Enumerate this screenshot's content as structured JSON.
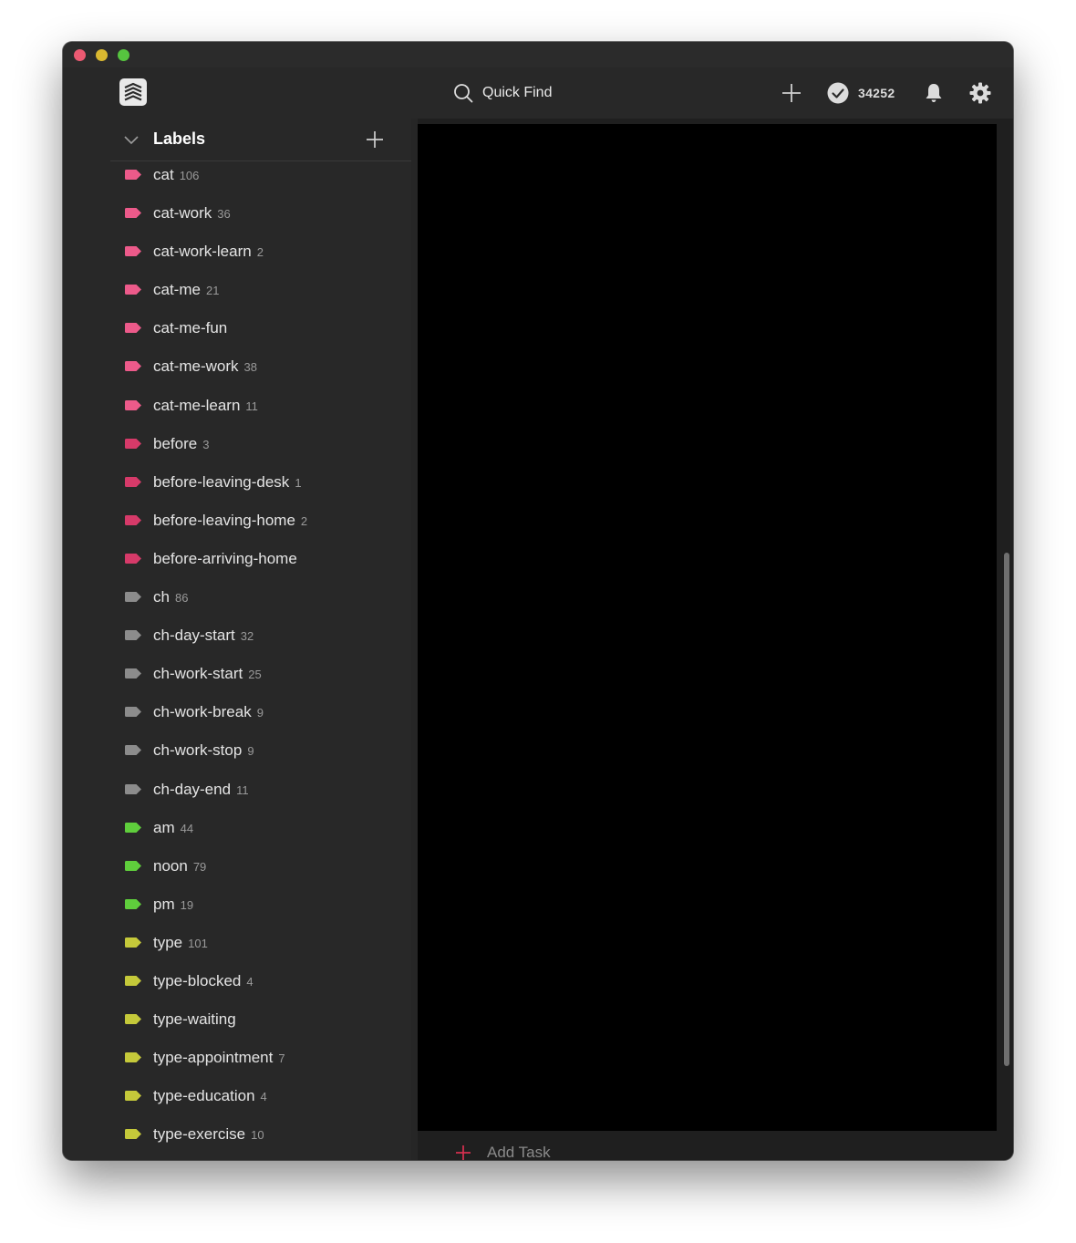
{
  "window": {
    "traffic_lights": [
      {
        "name": "close",
        "color": "#ec5a72"
      },
      {
        "name": "minimize",
        "color": "#d9b830"
      },
      {
        "name": "maximize",
        "color": "#56c43f"
      }
    ]
  },
  "topbar": {
    "logo_icon": "todoist-logo-icon",
    "quick_find": "Quick Find",
    "karma_count": "34252",
    "icons": [
      "search-icon",
      "plus-icon",
      "check-circle-icon",
      "bell-icon",
      "gear-icon"
    ]
  },
  "sidebar": {
    "section_title": "Labels",
    "labels": [
      {
        "name": "cat",
        "count": "106",
        "color": "#ec5a8a"
      },
      {
        "name": "cat-work",
        "count": "36",
        "color": "#ec5a8a"
      },
      {
        "name": "cat-work-learn",
        "count": "2",
        "color": "#ec5a8a"
      },
      {
        "name": "cat-me",
        "count": "21",
        "color": "#ec5a8a"
      },
      {
        "name": "cat-me-fun",
        "count": "",
        "color": "#ec5a8a"
      },
      {
        "name": "cat-me-work",
        "count": "38",
        "color": "#ec5a8a"
      },
      {
        "name": "cat-me-learn",
        "count": "11",
        "color": "#ec5a8a"
      },
      {
        "name": "before",
        "count": "3",
        "color": "#d63a69"
      },
      {
        "name": "before-leaving-desk",
        "count": "1",
        "color": "#d63a69"
      },
      {
        "name": "before-leaving-home",
        "count": "2",
        "color": "#d63a69"
      },
      {
        "name": "before-arriving-home",
        "count": "",
        "color": "#d63a69"
      },
      {
        "name": "ch",
        "count": "86",
        "color": "#8c8c8c"
      },
      {
        "name": "ch-day-start",
        "count": "32",
        "color": "#8c8c8c"
      },
      {
        "name": "ch-work-start",
        "count": "25",
        "color": "#8c8c8c"
      },
      {
        "name": "ch-work-break",
        "count": "9",
        "color": "#8c8c8c"
      },
      {
        "name": "ch-work-stop",
        "count": "9",
        "color": "#8c8c8c"
      },
      {
        "name": "ch-day-end",
        "count": "11",
        "color": "#8c8c8c"
      },
      {
        "name": "am",
        "count": "44",
        "color": "#5fce3c"
      },
      {
        "name": "noon",
        "count": "79",
        "color": "#5fce3c"
      },
      {
        "name": "pm",
        "count": "19",
        "color": "#5fce3c"
      },
      {
        "name": "type",
        "count": "101",
        "color": "#c5c93a"
      },
      {
        "name": "type-blocked",
        "count": "4",
        "color": "#c5c93a"
      },
      {
        "name": "type-waiting",
        "count": "",
        "color": "#c5c93a"
      },
      {
        "name": "type-appointment",
        "count": "7",
        "color": "#c5c93a"
      },
      {
        "name": "type-education",
        "count": "4",
        "color": "#c5c93a"
      },
      {
        "name": "type-exercise",
        "count": "10",
        "color": "#c5c93a"
      }
    ]
  },
  "main": {
    "add_task": "Add Task",
    "add_task_icon_color": "#d9304f"
  }
}
